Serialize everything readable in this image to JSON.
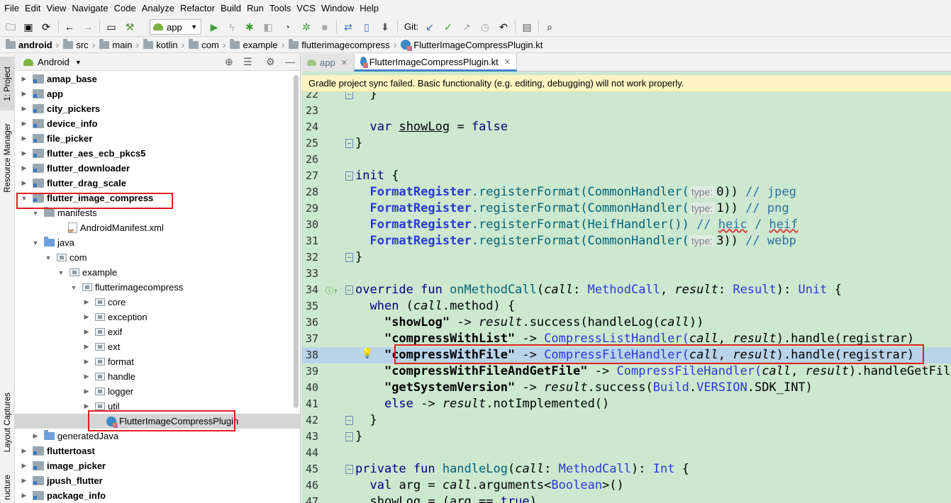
{
  "menu": [
    "File",
    "Edit",
    "View",
    "Navigate",
    "Code",
    "Analyze",
    "Refactor",
    "Build",
    "Run",
    "Tools",
    "VCS",
    "Window",
    "Help"
  ],
  "toolbar": {
    "run_config": "app",
    "git_label": "Git:"
  },
  "breadcrumb": [
    "android",
    "src",
    "main",
    "kotlin",
    "com",
    "example",
    "flutterimagecompress",
    "FlutterImageCompressPlugin.kt"
  ],
  "left_stripe": {
    "project": "1: Project",
    "resource_manager": "Resource Manager",
    "layout_captures": "Layout Captures",
    "structure": "ructure"
  },
  "project_panel": {
    "view_mode": "Android",
    "tree": [
      {
        "label": "amap_base",
        "bold": true
      },
      {
        "label": "app",
        "bold": true
      },
      {
        "label": "city_pickers",
        "bold": true
      },
      {
        "label": "device_info",
        "bold": true
      },
      {
        "label": "file_picker",
        "bold": true
      },
      {
        "label": "flutter_aes_ecb_pkcs5",
        "bold": true
      },
      {
        "label": "flutter_downloader",
        "bold": true
      },
      {
        "label": "flutter_drag_scale",
        "bold": true
      },
      {
        "label": "flutter_image_compress",
        "bold": true
      },
      {
        "label": "manifests",
        "bold": false
      },
      {
        "label": "AndroidManifest.xml",
        "bold": false
      },
      {
        "label": "java",
        "bold": false
      },
      {
        "label": "com",
        "bold": false
      },
      {
        "label": "example",
        "bold": false
      },
      {
        "label": "flutterimagecompress",
        "bold": false
      },
      {
        "label": "core",
        "bold": false
      },
      {
        "label": "exception",
        "bold": false
      },
      {
        "label": "exif",
        "bold": false
      },
      {
        "label": "ext",
        "bold": false
      },
      {
        "label": "format",
        "bold": false
      },
      {
        "label": "handle",
        "bold": false
      },
      {
        "label": "logger",
        "bold": false
      },
      {
        "label": "util",
        "bold": false
      },
      {
        "label": "FlutterImageCompressPlugin",
        "bold": false
      },
      {
        "label": "generatedJava",
        "bold": false
      },
      {
        "label": "fluttertoast",
        "bold": true
      },
      {
        "label": "image_picker",
        "bold": true
      },
      {
        "label": "jpush_flutter",
        "bold": true
      },
      {
        "label": "package_info",
        "bold": true
      }
    ]
  },
  "editor": {
    "tabs": [
      "app",
      "FlutterImageCompressPlugin.kt"
    ],
    "sync_banner": "Gradle project sync failed. Basic functionality (e.g. editing, debugging) will not work properly.",
    "current_line": 38,
    "lines": [
      {
        "n": "22",
        "parts": [
          [
            "  }",
            ""
          ]
        ]
      },
      {
        "n": "23",
        "parts": []
      },
      {
        "n": "24",
        "parts": [
          [
            "  ",
            ""
          ],
          [
            "var",
            "kw"
          ],
          [
            " ",
            ""
          ],
          [
            "showLog",
            "und fnv"
          ],
          [
            " = ",
            ""
          ],
          [
            "false",
            "kw"
          ]
        ]
      },
      {
        "n": "25",
        "parts": [
          [
            "}",
            ""
          ]
        ]
      },
      {
        "n": "26",
        "parts": []
      },
      {
        "n": "27",
        "parts": [
          [
            "init",
            "kw"
          ],
          [
            " {",
            ""
          ]
        ]
      },
      {
        "n": "28",
        "parts": [
          [
            "  ",
            ""
          ],
          [
            "FormatRegister",
            "obj"
          ],
          [
            ".registerFormat(CommonHandler(",
            "fn"
          ],
          [
            "type:",
            "hint"
          ],
          [
            "0",
            ""
          ],
          [
            ")) ",
            ""
          ],
          [
            "// jpeg",
            "cm"
          ]
        ]
      },
      {
        "n": "29",
        "parts": [
          [
            "  ",
            ""
          ],
          [
            "FormatRegister",
            "obj"
          ],
          [
            ".registerFormat(CommonHandler(",
            "fn"
          ],
          [
            "type:",
            "hint"
          ],
          [
            "1",
            ""
          ],
          [
            ")) ",
            ""
          ],
          [
            "// png",
            "cm"
          ]
        ]
      },
      {
        "n": "30",
        "parts": [
          [
            "  ",
            ""
          ],
          [
            "FormatRegister",
            "obj"
          ],
          [
            ".registerFormat(HeifHandler()) ",
            "fn"
          ],
          [
            "// ",
            "cm"
          ],
          [
            "heic",
            "cm wav"
          ],
          [
            " / ",
            "cm"
          ],
          [
            "heif",
            "cm wav"
          ]
        ]
      },
      {
        "n": "31",
        "parts": [
          [
            "  ",
            ""
          ],
          [
            "FormatRegister",
            "obj"
          ],
          [
            ".registerFormat(CommonHandler(",
            "fn"
          ],
          [
            "type:",
            "hint"
          ],
          [
            "3",
            ""
          ],
          [
            ")) ",
            ""
          ],
          [
            "// webp",
            "cm"
          ]
        ]
      },
      {
        "n": "32",
        "parts": [
          [
            "}",
            ""
          ]
        ]
      },
      {
        "n": "33",
        "parts": []
      },
      {
        "n": "34",
        "parts": [
          [
            "override fun ",
            "kw"
          ],
          [
            "onMethodCall",
            "fn"
          ],
          [
            "(",
            ""
          ],
          [
            "call",
            "it"
          ],
          [
            ": ",
            ""
          ],
          [
            "MethodCall",
            "ty"
          ],
          [
            ", ",
            ""
          ],
          [
            "result",
            "it"
          ],
          [
            ": ",
            ""
          ],
          [
            "Result",
            "ty"
          ],
          [
            "): ",
            ""
          ],
          [
            "Unit",
            "ty"
          ],
          [
            " {",
            ""
          ]
        ]
      },
      {
        "n": "35",
        "parts": [
          [
            "  ",
            ""
          ],
          [
            "when",
            "kw"
          ],
          [
            " (",
            ""
          ],
          [
            "call",
            "it"
          ],
          [
            ".method) {",
            ""
          ]
        ]
      },
      {
        "n": "36",
        "parts": [
          [
            "    ",
            ""
          ],
          [
            "\"showLog\"",
            "str"
          ],
          [
            " -> ",
            ""
          ],
          [
            "result",
            "it"
          ],
          [
            ".success(handleLog(",
            ""
          ],
          [
            "call",
            "it"
          ],
          [
            "))",
            ""
          ]
        ]
      },
      {
        "n": "37",
        "parts": [
          [
            "    ",
            ""
          ],
          [
            "\"compressWithList\"",
            "str"
          ],
          [
            " -> ",
            ""
          ],
          [
            "CompressListHandler(",
            "ty"
          ],
          [
            "call",
            "it"
          ],
          [
            ", ",
            ""
          ],
          [
            "result",
            "it"
          ],
          [
            ").handle(registrar)",
            ""
          ]
        ]
      },
      {
        "n": "38",
        "parts": [
          [
            "    ",
            ""
          ],
          [
            "\"compressWithFile\"",
            "str"
          ],
          [
            " -> ",
            ""
          ],
          [
            "CompressFileHandler(",
            "ty"
          ],
          [
            "call",
            "it"
          ],
          [
            ", ",
            ""
          ],
          [
            "result",
            "it"
          ],
          [
            ").handle(registrar)",
            ""
          ]
        ]
      },
      {
        "n": "39",
        "parts": [
          [
            "    ",
            ""
          ],
          [
            "\"compressWithFileAndGetFile\"",
            "str"
          ],
          [
            " -> ",
            ""
          ],
          [
            "CompressFileHandler(",
            "ty"
          ],
          [
            "call",
            "it"
          ],
          [
            ", ",
            ""
          ],
          [
            "result",
            "it"
          ],
          [
            ").handleGetFil",
            ""
          ]
        ]
      },
      {
        "n": "40",
        "parts": [
          [
            "    ",
            ""
          ],
          [
            "\"getSystemVersion\"",
            "str"
          ],
          [
            " -> ",
            ""
          ],
          [
            "result",
            "it"
          ],
          [
            ".success(",
            ""
          ],
          [
            "Build",
            "ty"
          ],
          [
            ".",
            ""
          ],
          [
            "VERSION",
            "ty"
          ],
          [
            ".SDK_INT)",
            ""
          ]
        ]
      },
      {
        "n": "41",
        "parts": [
          [
            "    ",
            ""
          ],
          [
            "else",
            "kw"
          ],
          [
            " -> ",
            ""
          ],
          [
            "result",
            "it"
          ],
          [
            ".notImplemented()",
            ""
          ]
        ]
      },
      {
        "n": "42",
        "parts": [
          [
            "  }",
            ""
          ]
        ]
      },
      {
        "n": "43",
        "parts": [
          [
            "}",
            ""
          ]
        ]
      },
      {
        "n": "44",
        "parts": []
      },
      {
        "n": "45",
        "parts": [
          [
            "private fun ",
            "kw"
          ],
          [
            "handleLog",
            "fn"
          ],
          [
            "(",
            ""
          ],
          [
            "call",
            "it"
          ],
          [
            ": ",
            ""
          ],
          [
            "MethodCall",
            "ty"
          ],
          [
            "): ",
            ""
          ],
          [
            "Int",
            "ty"
          ],
          [
            " {",
            ""
          ]
        ]
      },
      {
        "n": "46",
        "parts": [
          [
            "  ",
            ""
          ],
          [
            "val",
            "kw"
          ],
          [
            " arg = ",
            ""
          ],
          [
            "call",
            "it"
          ],
          [
            ".arguments<",
            ""
          ],
          [
            "Boolean",
            "ty"
          ],
          [
            ">()",
            ""
          ]
        ]
      },
      {
        "n": "47",
        "parts": [
          [
            "  showLog = (arg == ",
            ""
          ],
          [
            "true",
            "kw"
          ],
          [
            ")",
            ""
          ]
        ]
      }
    ]
  },
  "colors": {
    "editor_bg": "#cce8cf",
    "current_line": "#b9d3e9",
    "annotation": "#e0201b",
    "banner": "#fdf4c1"
  }
}
